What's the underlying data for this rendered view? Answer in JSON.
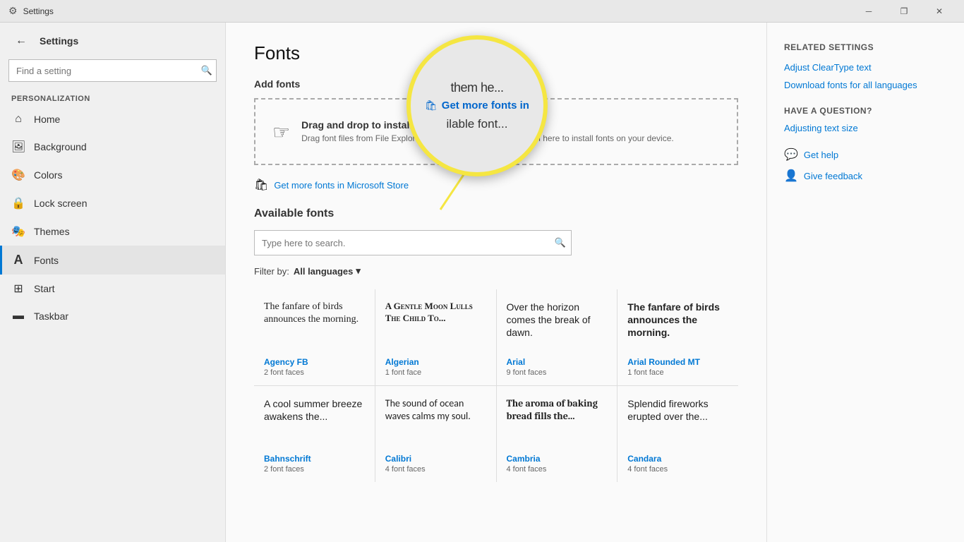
{
  "titleBar": {
    "title": "Settings",
    "minimizeLabel": "─",
    "restoreLabel": "❐",
    "closeLabel": "✕"
  },
  "sidebar": {
    "backLabel": "←",
    "appTitle": "Settings",
    "searchPlaceholder": "Find a setting",
    "sectionLabel": "Personalization",
    "navItems": [
      {
        "id": "home",
        "icon": "⌂",
        "label": "Home"
      },
      {
        "id": "background",
        "icon": "🖼",
        "label": "Background"
      },
      {
        "id": "colors",
        "icon": "🎨",
        "label": "Colors"
      },
      {
        "id": "lock-screen",
        "icon": "🔒",
        "label": "Lock screen"
      },
      {
        "id": "themes",
        "icon": "🎭",
        "label": "Themes"
      },
      {
        "id": "fonts",
        "icon": "A",
        "label": "Fonts",
        "active": true
      },
      {
        "id": "start",
        "icon": "⊞",
        "label": "Start"
      },
      {
        "id": "taskbar",
        "icon": "▬",
        "label": "Taskbar"
      }
    ]
  },
  "main": {
    "pageTitle": "Fonts",
    "addFontsHeading": "Add fonts",
    "dropAreaTitle": "Drag and drop to install",
    "dropAreaDesc": "Drag font files from File Explorer or your desktop and drop them here to install fonts on your device.",
    "storeLinkText": "Get more fonts in Microsoft Store",
    "availableFontsHeading": "Available fonts",
    "searchPlaceholder": "Type here to search.",
    "filterLabel": "Filter by:",
    "filterValue": "All languages",
    "fontCards": [
      {
        "previewText": "The fanfare of birds announces the morning.",
        "fontFamily": "serif",
        "fontName": "Agency FB",
        "fontFaces": "2 font faces"
      },
      {
        "previewText": "A GENTLE MOON LULLS THE CHILD TO...",
        "fontFamily": "serif",
        "fontStyle": "small-caps",
        "fontName": "Algerian",
        "fontFaces": "1 font face"
      },
      {
        "previewText": "Over the horizon comes the break of dawn.",
        "fontFamily": "Arial, sans-serif",
        "fontName": "Arial",
        "fontFaces": "9 font faces"
      },
      {
        "previewText": "The fanfare of birds announces the morning.",
        "fontFamily": "Arial Rounded MT Bold, sans-serif",
        "fontWeight": "bold",
        "fontName": "Arial Rounded MT",
        "fontFaces": "1 font face"
      },
      {
        "previewText": "A cool summer breeze awakens the...",
        "fontFamily": "serif",
        "fontName": "Bahnschrift",
        "fontFaces": "2 font faces"
      },
      {
        "previewText": "The sound of ocean waves calms my soul.",
        "fontFamily": "serif",
        "fontName": "Calibri",
        "fontFaces": "4 font faces"
      },
      {
        "previewText": "The aroma of baking bread fills the...",
        "fontFamily": "serif",
        "fontWeight": "bold",
        "fontName": "Cambria",
        "fontFaces": "4 font faces"
      },
      {
        "previewText": "Splendid fireworks erupted over the...",
        "fontFamily": "sans-serif",
        "fontName": "Candara",
        "fontFaces": "4 font faces"
      }
    ]
  },
  "rightPanel": {
    "relatedTitle": "Related Settings",
    "relatedLinks": [
      "Adjust ClearType text",
      "Download fonts for all languages"
    ],
    "questionTitle": "Have a question?",
    "questionLink": "Adjusting text size",
    "helpTitle": "Get help Give feedback",
    "helpItems": [
      {
        "icon": "💬",
        "label": "Get help"
      },
      {
        "icon": "👤",
        "label": "Give feedback"
      }
    ]
  },
  "magnify": {
    "topText": "them he...",
    "storeText": "Get more fonts in",
    "availableText": "ilable font..."
  }
}
